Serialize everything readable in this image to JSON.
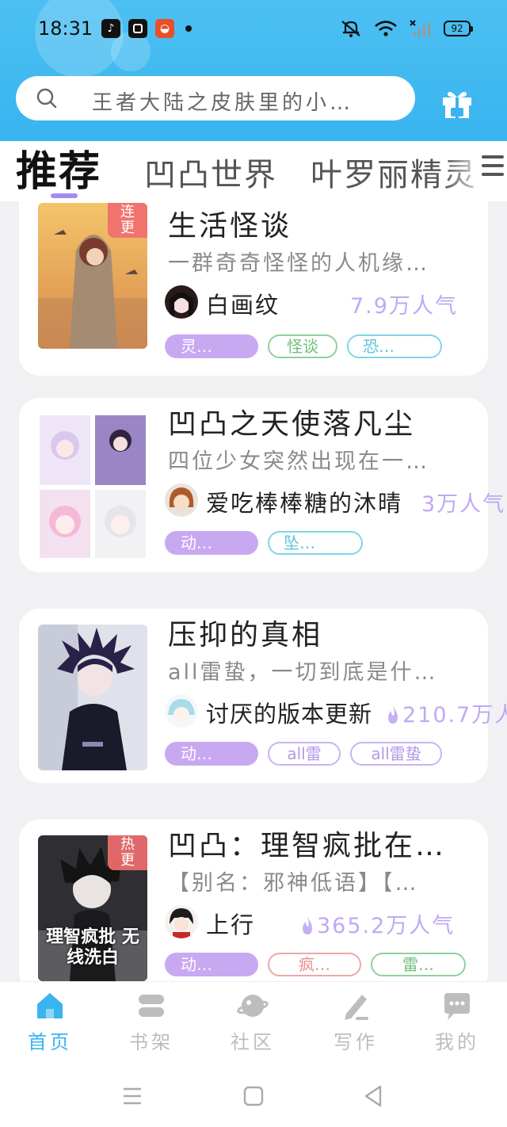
{
  "status_bar": {
    "time": "18:31",
    "battery": "92",
    "app_icon_3_glyph": "◒"
  },
  "search": {
    "placeholder": "王者大陆之皮肤里的小…"
  },
  "tabs": [
    {
      "label": "推荐",
      "active": true
    },
    {
      "label": "凹凸世界",
      "active": false
    },
    {
      "label": "叶罗丽精灵",
      "active": false
    }
  ],
  "books": [
    {
      "badge": "连更",
      "title": "生活怪谈",
      "description": "一群奇奇怪怪的人机缘…",
      "author": "白画纹",
      "popularity": "7.9万人气",
      "tags": [
        {
          "label": "灵…",
          "style": "purple"
        },
        {
          "label": "怪谈",
          "style": "green"
        },
        {
          "label": "恐…",
          "style": "cyan"
        }
      ]
    },
    {
      "badge": "",
      "title": "凹凸之天使落凡尘",
      "description": "四位少女突然出现在一…",
      "author": "爱吃棒棒糖的沐晴",
      "popularity": "3万人气",
      "tags": [
        {
          "label": "动…",
          "style": "purple"
        },
        {
          "label": "坠…",
          "style": "cyan"
        }
      ]
    },
    {
      "badge": "",
      "title": "压抑的真相",
      "description": "all雷蛰，一切到底是什…",
      "author": "讨厌的版本更新",
      "popularity": "210.7万人",
      "tags": [
        {
          "label": "动…",
          "style": "purple"
        },
        {
          "label": "all雷",
          "style": "lav"
        },
        {
          "label": "all雷蛰",
          "style": "lav"
        }
      ]
    },
    {
      "badge": "热更",
      "title": "凹凸：理智疯批在…",
      "description": "【别名：邪神低语】【…",
      "author": "上行",
      "popularity": "365.2万人气",
      "cover_text": "理智疯批 无线洗白",
      "tags": [
        {
          "label": "动…",
          "style": "purple"
        },
        {
          "label": "疯…",
          "style": "pink"
        },
        {
          "label": "雷…",
          "style": "green"
        }
      ]
    }
  ],
  "bottom_nav": [
    {
      "label": "首页",
      "icon": "home-icon",
      "active": true
    },
    {
      "label": "书架",
      "icon": "bookshelf-icon",
      "active": false
    },
    {
      "label": "社区",
      "icon": "planet-icon",
      "active": false
    },
    {
      "label": "写作",
      "icon": "pen-icon",
      "active": false
    },
    {
      "label": "我的",
      "icon": "chat-bubble-icon",
      "active": false
    }
  ],
  "colors": {
    "header": "#39b4ef",
    "accent_purple": "#c9a8f2",
    "popularity": "#bfa9f3",
    "nav_active": "#39b4ef"
  }
}
